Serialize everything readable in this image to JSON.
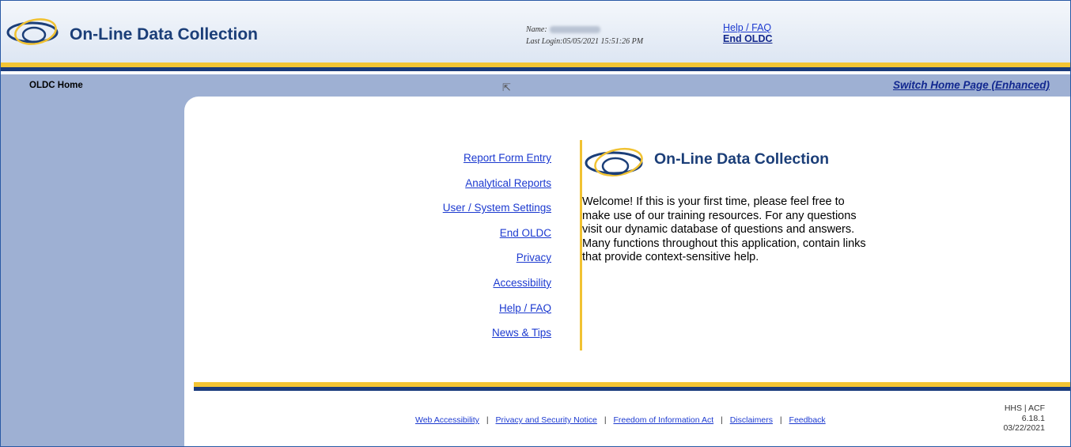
{
  "colors": {
    "navy": "#1b3e78",
    "gold": "#f3c433",
    "sidebar_blue": "#9eb0d3",
    "link": "#1c3ad0"
  },
  "header": {
    "title": "On-Line Data Collection",
    "logo_icon": "oldc-ellipses-logo-icon",
    "name_label": "Name:",
    "last_login_label": "Last Login:",
    "last_login_value": "05/05/2021 15:51:26 PM",
    "help_link": "Help / FAQ",
    "end_link": "End OLDC"
  },
  "navbar": {
    "current_page": "OLDC Home",
    "switch_link": "Switch Home Page (Enhanced)"
  },
  "main": {
    "links": [
      "Report Form Entry",
      "Analytical Reports",
      "User / System Settings",
      "End OLDC",
      "Privacy",
      "Accessibility",
      "Help / FAQ",
      "News & Tips"
    ],
    "panel_title": "On-Line Data Collection",
    "welcome_text": "Welcome! If this is your first time, please feel free to make use of our training resources. For any questions visit our dynamic database of questions and answers. Many functions throughout this application, contain links that provide context-sensitive help."
  },
  "footer": {
    "links": [
      "Web Accessibility",
      "Privacy and Security Notice",
      "Freedom of Information Act",
      "Disclaimers",
      "Feedback"
    ],
    "separator": "|",
    "agency": "HHS | ACF",
    "version": "6.18.1",
    "date": "03/22/2021"
  }
}
